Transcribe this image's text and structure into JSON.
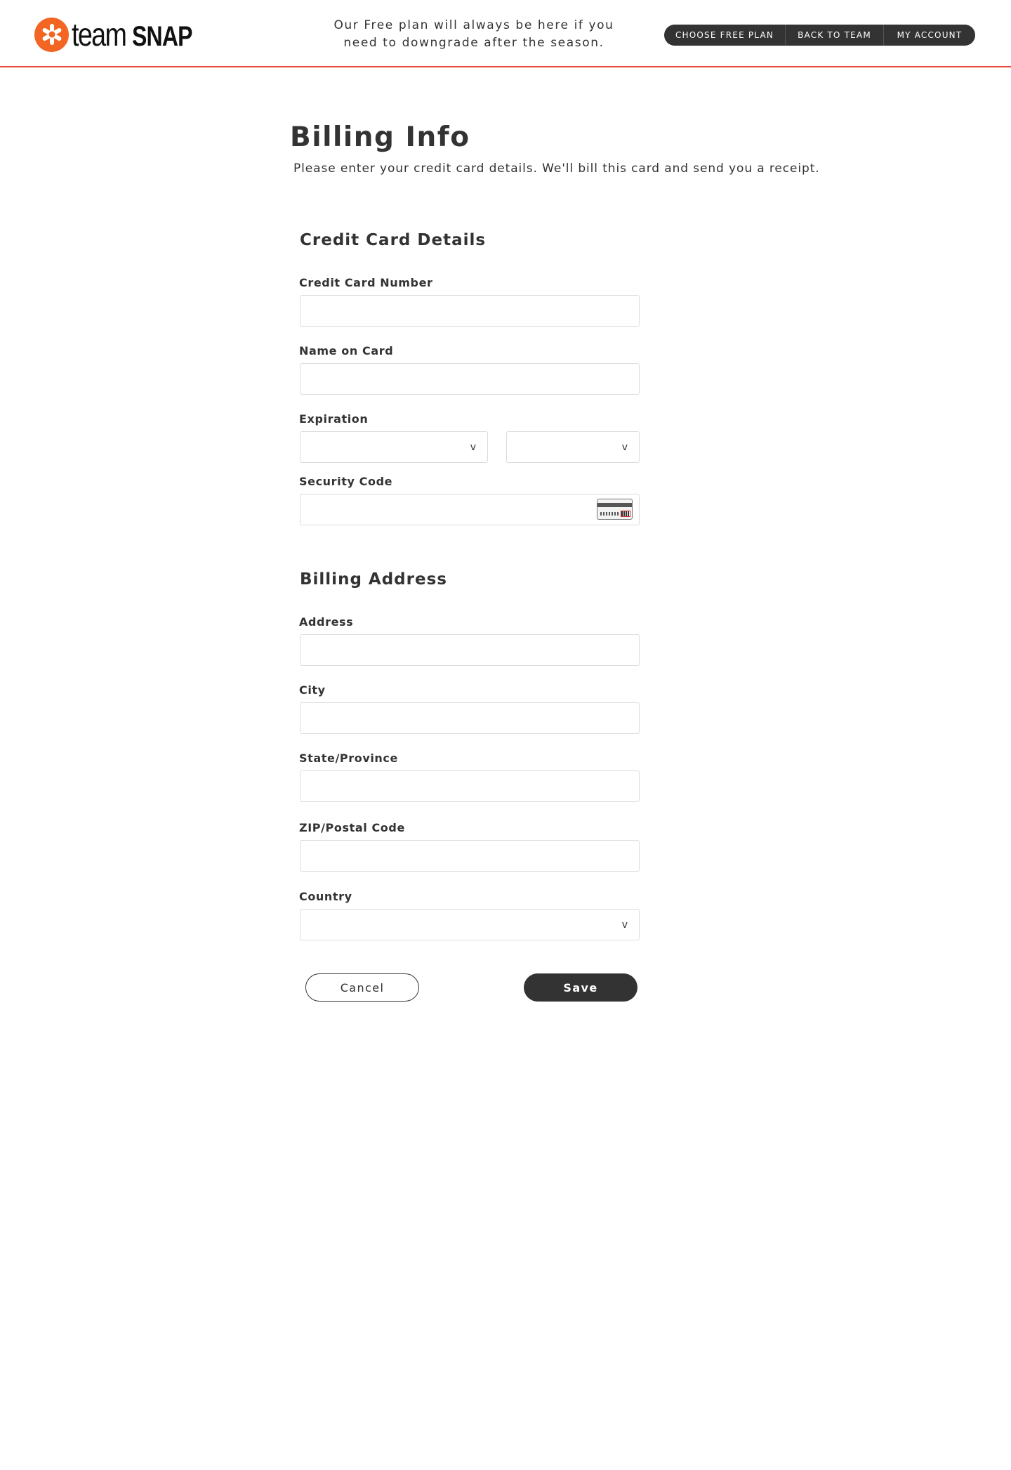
{
  "brand": {
    "name_part1": "team",
    "name_part2": "SNAP",
    "logo_color": "#f26522",
    "accent_line_color": "#e8453c"
  },
  "header": {
    "note": "Our Free plan will always be here if you need to downgrade after the season.",
    "nav": [
      {
        "label": "CHOOSE FREE PLAN"
      },
      {
        "label": "BACK TO TEAM"
      },
      {
        "label": "MY ACCOUNT"
      }
    ]
  },
  "page": {
    "title": "Billing Info",
    "subtitle": "Please enter your credit card details. We'll bill this card and send you a receipt."
  },
  "credit_card": {
    "section_title": "Credit Card Details",
    "card_number_label": "Credit Card Number",
    "card_number_value": "",
    "name_label": "Name on Card",
    "name_value": "",
    "expiration_label": "Expiration",
    "expiration_month_value": "",
    "expiration_year_value": "",
    "security_code_label": "Security Code",
    "security_code_value": "",
    "security_code_icon": "cvv-card-icon"
  },
  "billing_address": {
    "section_title": "Billing Address",
    "address_label": "Address",
    "address_value": "",
    "city_label": "City",
    "city_value": "",
    "state_label": "State/Province",
    "state_value": "",
    "zip_label": "ZIP/Postal Code",
    "zip_value": "",
    "country_label": "Country",
    "country_value": ""
  },
  "select_chevron": "v",
  "actions": {
    "cancel_label": "Cancel",
    "save_label": "Save"
  }
}
